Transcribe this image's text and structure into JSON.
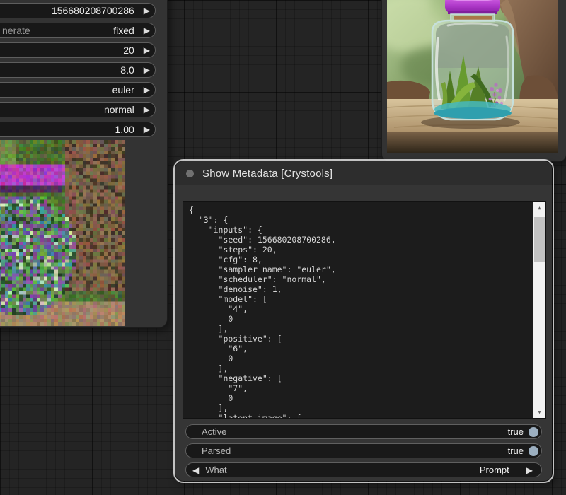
{
  "icons": {
    "arrow_right": "▶",
    "arrow_left": "◀",
    "scroll_up": "▲",
    "scroll_down": "▼"
  },
  "left_node": {
    "widgets": [
      {
        "label": "",
        "value": "156680208700286"
      },
      {
        "label": "nerate",
        "value": "fixed"
      },
      {
        "label": "",
        "value": "20"
      },
      {
        "label": "",
        "value": "8.0"
      },
      {
        "label": "",
        "value": "euler"
      },
      {
        "label": "",
        "value": "normal"
      },
      {
        "label": "",
        "value": "1.00"
      }
    ]
  },
  "metadata_node": {
    "title": "Show Metadata [Crystools]",
    "json_lines": [
      "{",
      "  \"3\": {",
      "    \"inputs\": {",
      "      \"seed\": 156680208700286,",
      "      \"steps\": 20,",
      "      \"cfg\": 8,",
      "      \"sampler_name\": \"euler\",",
      "      \"scheduler\": \"normal\",",
      "      \"denoise\": 1,",
      "      \"model\": [",
      "        \"4\",",
      "        0",
      "      ],",
      "      \"positive\": [",
      "        \"6\",",
      "        0",
      "      ],",
      "      \"negative\": [",
      "        \"7\",",
      "        0",
      "      ],",
      "      \"latent_image\": ["
    ],
    "toggles": [
      {
        "label": "Active",
        "value": "true"
      },
      {
        "label": "Parsed",
        "value": "true"
      }
    ],
    "selector": {
      "label": "What",
      "value": "Prompt"
    }
  },
  "colors": {
    "canvas_bg": "#242424",
    "node_bg": "#353535",
    "widget_bg": "#181818",
    "code_bg": "#1c1c1c",
    "toggle_on": "#9cafc0",
    "selected_outline": "#e1e1e1",
    "scrollbar_track": "#f2f2f2",
    "scrollbar_thumb": "#c2c2c2",
    "lid_purple": "#b13bcb"
  }
}
